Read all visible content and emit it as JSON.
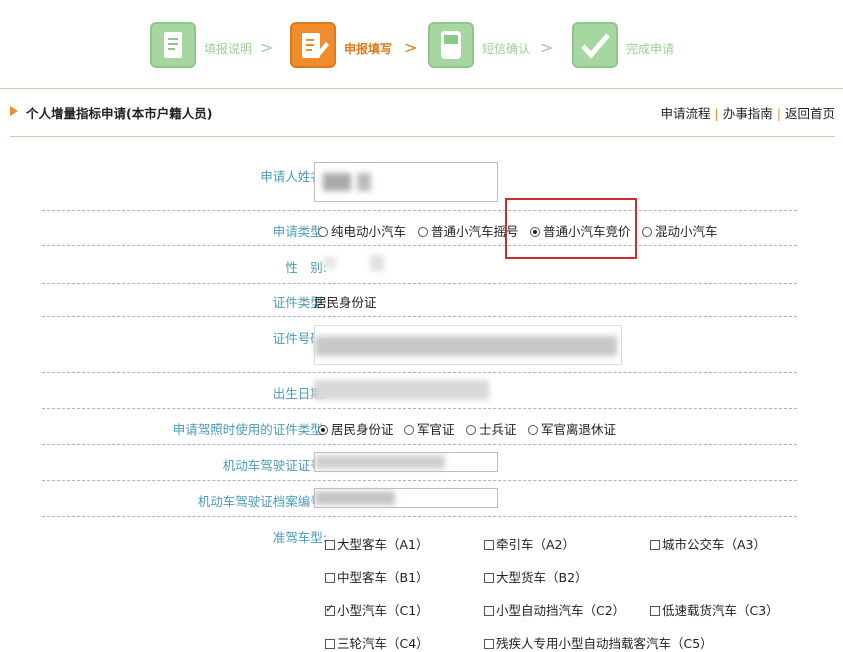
{
  "steps": [
    {
      "label": "填报说明",
      "arrow": ">",
      "state": "done"
    },
    {
      "label": "申报填写",
      "arrow": ">",
      "state": "active"
    },
    {
      "label": "短信确认",
      "arrow": ">",
      "state": "pending"
    },
    {
      "label": "完成申请",
      "arrow": "",
      "state": "pending"
    }
  ],
  "header": {
    "title": "个人增量指标申请(本市户籍人员)",
    "links": [
      "申请流程",
      "办事指南",
      "返回首页"
    ],
    "separator": "|"
  },
  "form": {
    "name_label": "申请人姓名:",
    "type_label": "申请类型:",
    "type_options": [
      "纯电动小汽车",
      "普通小汽车摇号",
      "普通小汽车竞价",
      "混动小汽车"
    ],
    "type_selected": 2,
    "gender_label": "性　别:",
    "id_type_label": "证件类型:",
    "id_type_value": "居民身份证",
    "id_number_label": "证件号码:",
    "birth_label": "出生日期:",
    "license_id_type_label": "申请驾照时使用的证件类型:",
    "license_id_options": [
      "居民身份证",
      "军官证",
      "士兵证",
      "军官离退休证"
    ],
    "license_id_selected": 0,
    "license_number_label": "机动车驾驶证证号:",
    "license_file_label": "机动车驾驶证档案编号:",
    "vehicle_class_label": "准驾车型:",
    "vehicle_classes": [
      {
        "label": "大型客车（A1）",
        "checked": false
      },
      {
        "label": "牵引车（A2）",
        "checked": false
      },
      {
        "label": "城市公交车（A3）",
        "checked": false
      },
      {
        "label": "中型客车（B1）",
        "checked": false
      },
      {
        "label": "大型货车（B2）",
        "checked": false
      },
      {
        "label": "小型汽车（C1）",
        "checked": true
      },
      {
        "label": "小型自动挡汽车（C2）",
        "checked": false
      },
      {
        "label": "低速载货汽车（C3）",
        "checked": false
      },
      {
        "label": "三轮汽车（C4）",
        "checked": false
      },
      {
        "label": "残疾人专用小型自动挡载客汽车（C5）",
        "checked": false
      }
    ]
  },
  "colors": {
    "accent": "#f08c2d",
    "done": "#a6d7a0",
    "label": "#4a9bb7",
    "highlight": "#d12b2b"
  }
}
